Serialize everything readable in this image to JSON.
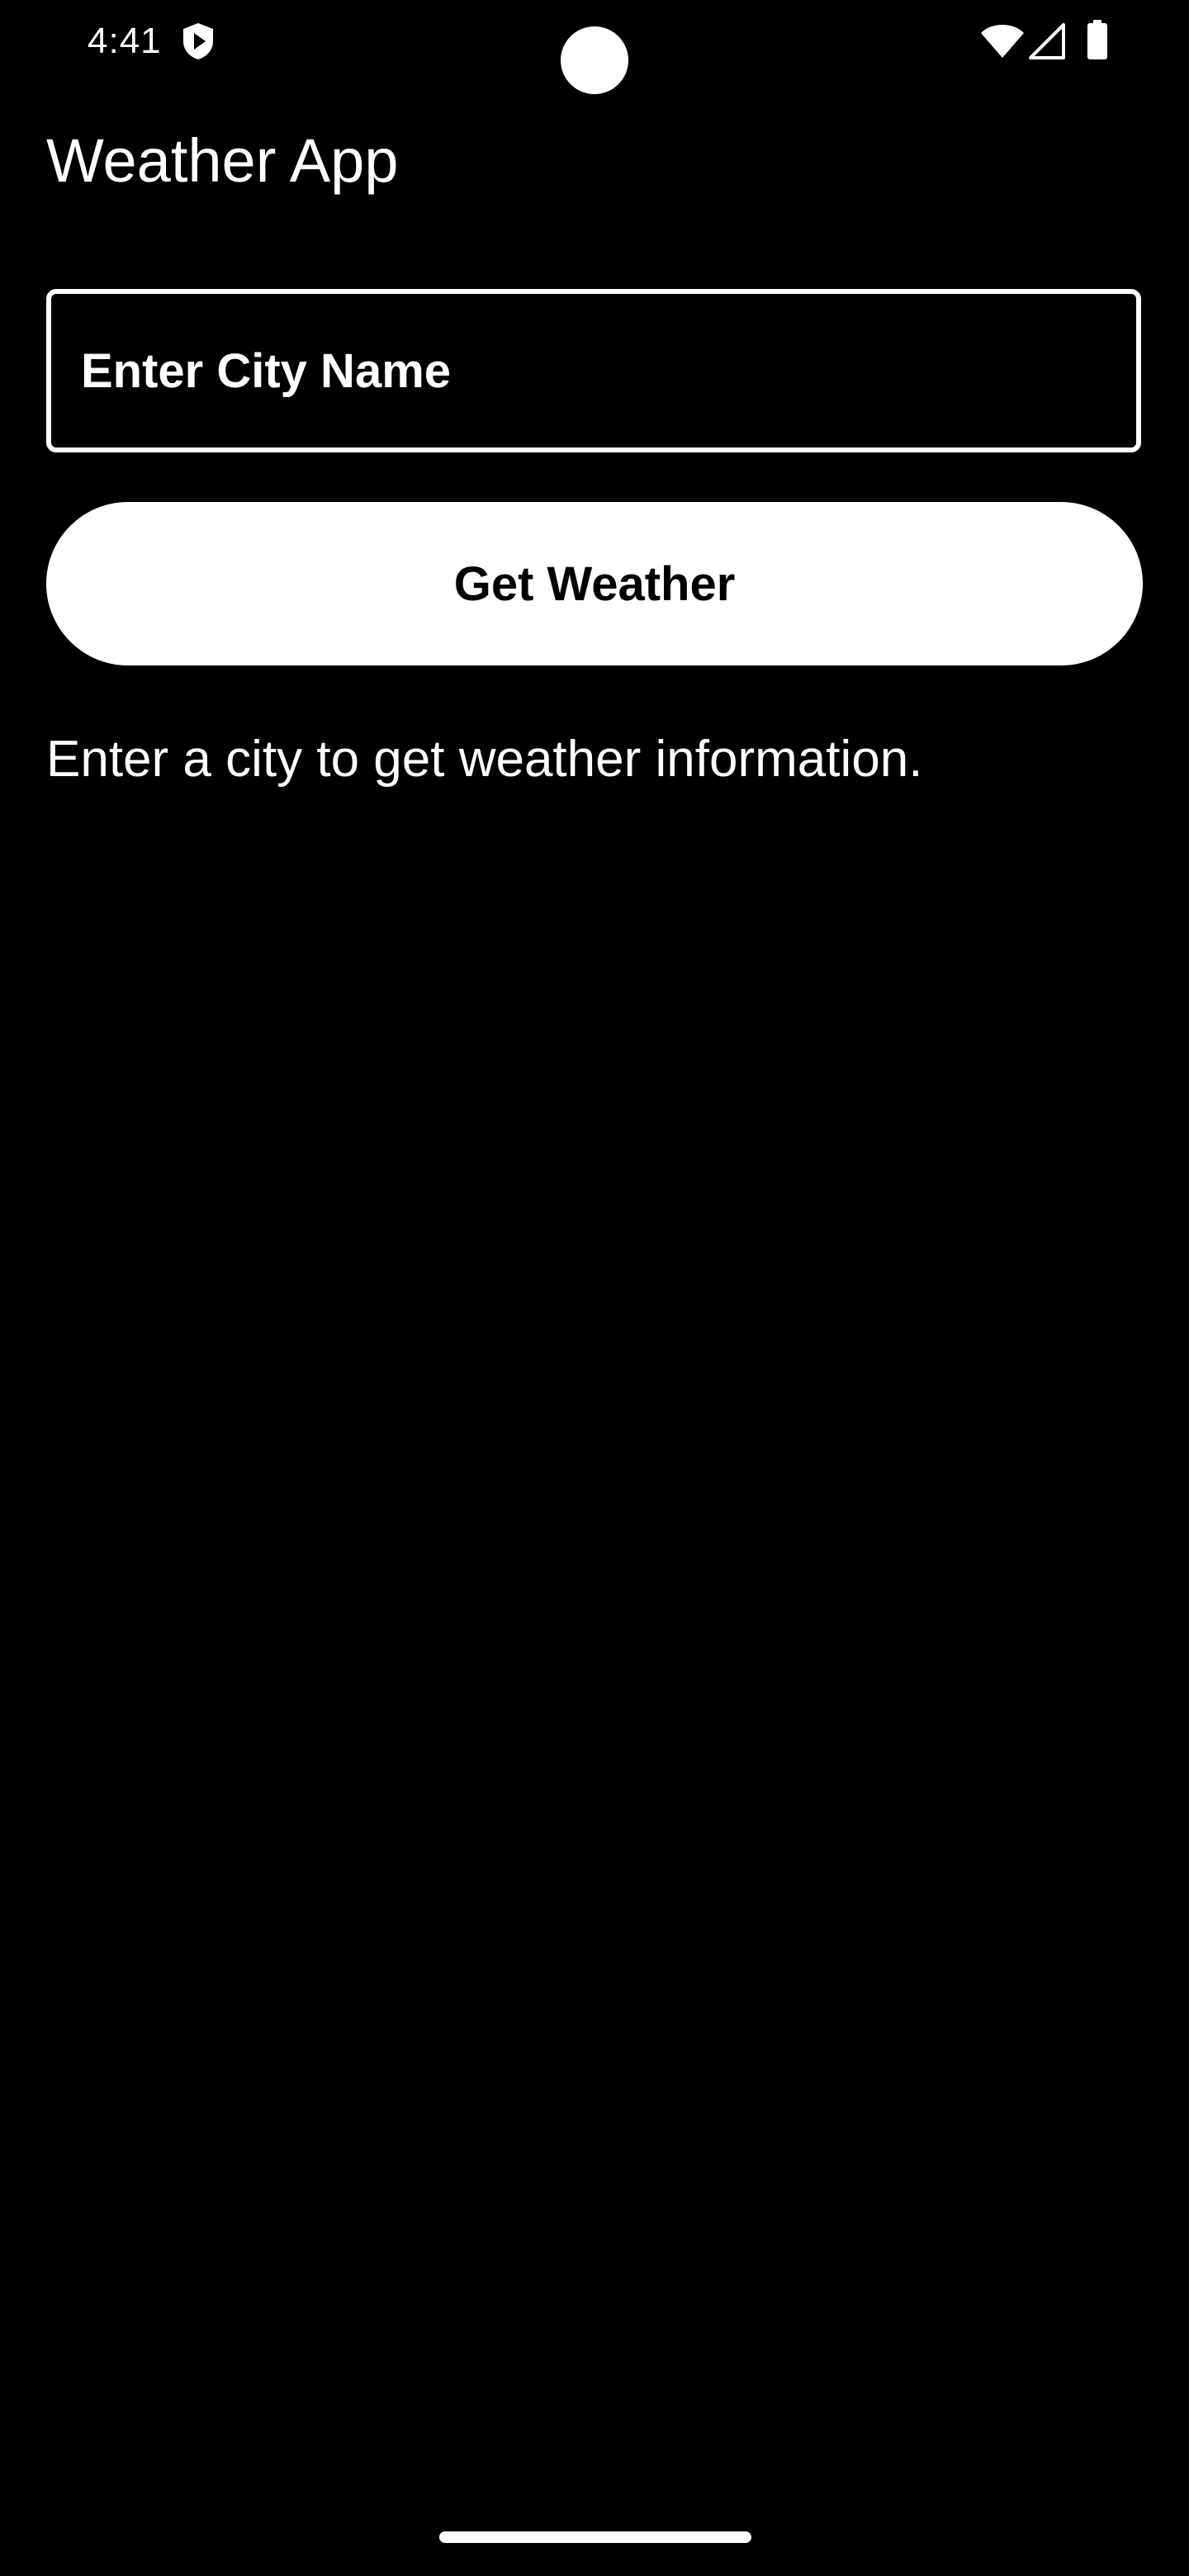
{
  "status_bar": {
    "time": "4:41",
    "icons": [
      "shield-play-icon",
      "wifi-icon",
      "signal-icon",
      "battery-icon"
    ]
  },
  "app": {
    "title": "Weather App"
  },
  "city_input": {
    "placeholder": "Enter City Name",
    "value": ""
  },
  "get_weather_button": {
    "label": "Get Weather"
  },
  "info": {
    "text": "Enter a city to get weather information."
  },
  "colors": {
    "background": "#000000",
    "foreground": "#ffffff",
    "button_text": "#000000"
  }
}
